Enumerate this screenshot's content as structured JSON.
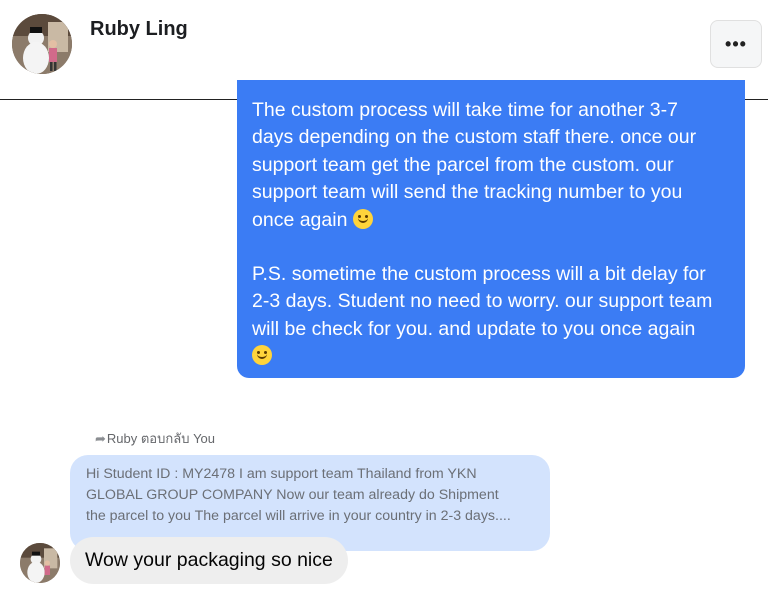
{
  "header": {
    "contact_name": "Ruby Ling",
    "more_button_label": "•••"
  },
  "outgoing_message": {
    "para1": [
      "The custom process  will take time for another 3-7",
      "days depending on the custom staff there. once our",
      "support team  get the parcel from the custom. our",
      "support team will send the tracking number to you",
      "once again"
    ],
    "para2": [
      "P.S. sometime the custom process will a bit delay for",
      "2-3 days. Student no need to worry. our support team",
      "will be check for you. and update to you once again"
    ],
    "emoji": "slightly-smiling-face"
  },
  "reply": {
    "label": "Ruby ตอบกลับ You",
    "quoted_lines": [
      "Hi Student ID : MY2478 I am support team Thailand from YKN",
      "GLOBAL GROUP COMPANY Now our team already do Shipment",
      "the parcel to you The parcel will arrive in your country in 2-3 days...."
    ]
  },
  "incoming_message": {
    "text": "Wow your packaging so nice"
  },
  "colors": {
    "outgoing_bubble": "#3b7cf4",
    "quoted_bubble": "#d3e3fd",
    "incoming_bubble": "#eeeeee"
  }
}
